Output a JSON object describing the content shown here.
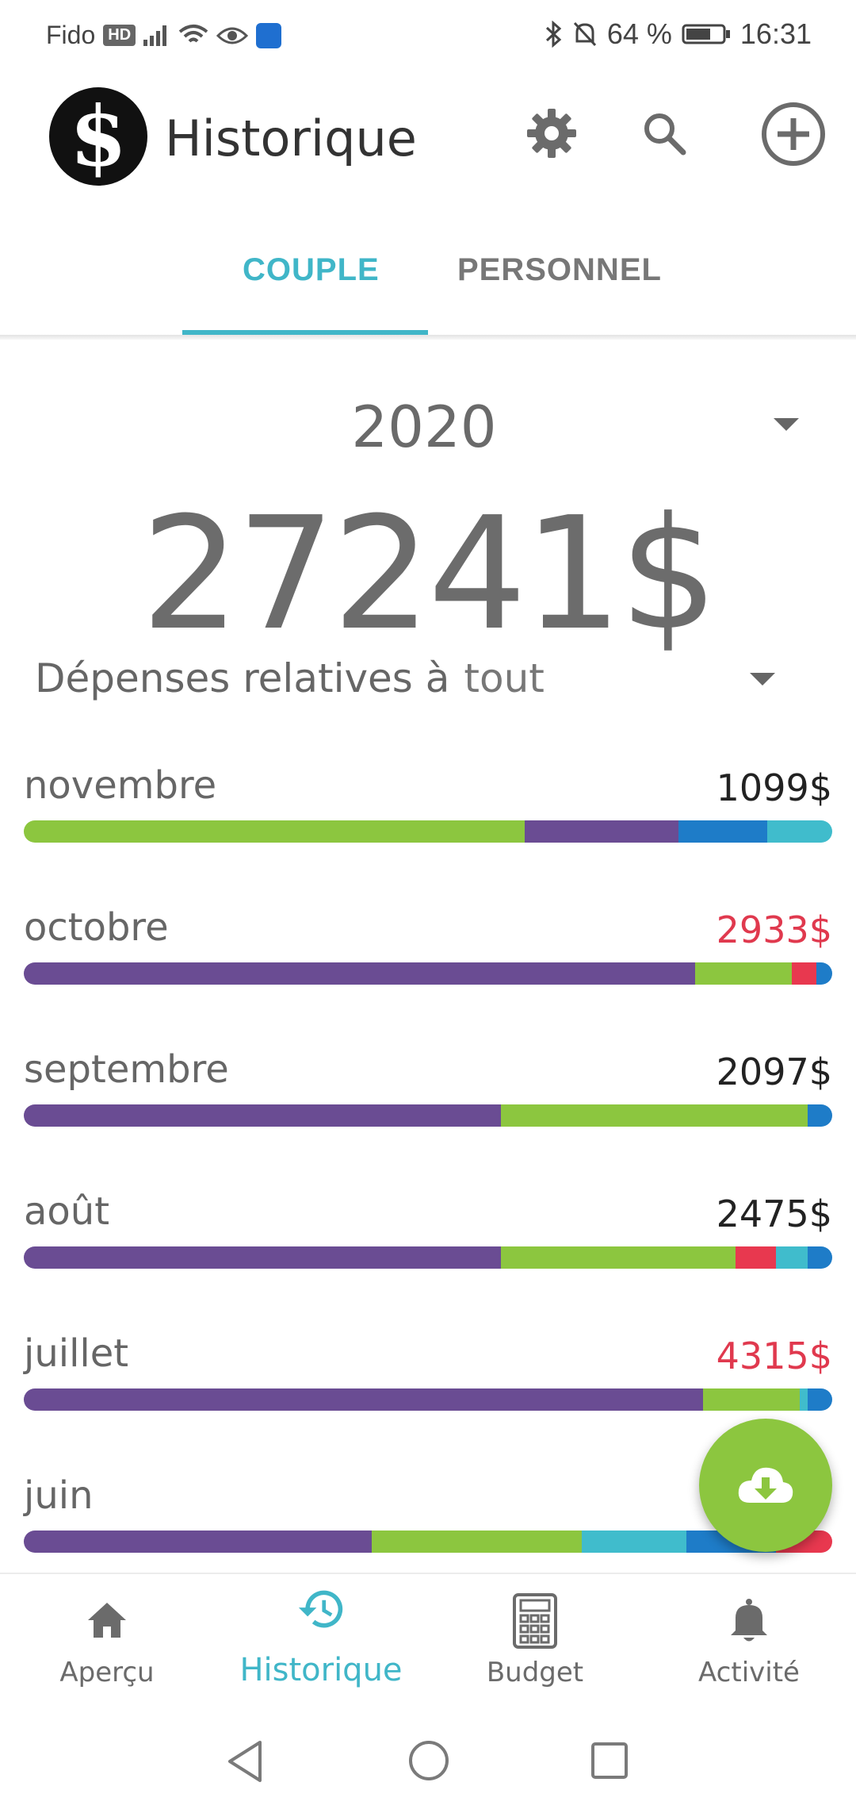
{
  "status_bar": {
    "carrier": "Fido",
    "hd": "HD",
    "battery": "64 %",
    "time": "16:31"
  },
  "app_bar": {
    "logo": "$",
    "title": "Historique",
    "icons": [
      "gear-icon",
      "search-icon",
      "add-circle-icon"
    ]
  },
  "tabs": [
    {
      "label": "COUPLE",
      "active": true
    },
    {
      "label": "PERSONNEL",
      "active": false
    }
  ],
  "summary": {
    "year": "2020",
    "total": "27241$",
    "relative_label": "Dépenses relatives à",
    "relative_value": "tout"
  },
  "colors": {
    "accent": "#40b6c8",
    "green": "#8cc63f",
    "purple": "#6a4c93",
    "blue": "#1e7cc8",
    "cyan": "#40bccc",
    "red": "#e8384f",
    "over_budget": "#e0394e"
  },
  "months": [
    {
      "name": "novembre",
      "amount": "1099$",
      "over": false,
      "segments": [
        {
          "c": "#8cc63f",
          "f": 0.62
        },
        {
          "c": "#6a4c93",
          "f": 0.19
        },
        {
          "c": "#1e7cc8",
          "f": 0.11
        },
        {
          "c": "#40bccc",
          "f": 0.08
        }
      ]
    },
    {
      "name": "octobre",
      "amount": "2933$",
      "over": true,
      "segments": [
        {
          "c": "#6a4c93",
          "f": 0.83
        },
        {
          "c": "#8cc63f",
          "f": 0.12
        },
        {
          "c": "#e8384f",
          "f": 0.03
        },
        {
          "c": "#1e7cc8",
          "f": 0.02
        }
      ]
    },
    {
      "name": "septembre",
      "amount": "2097$",
      "over": false,
      "segments": [
        {
          "c": "#6a4c93",
          "f": 0.59
        },
        {
          "c": "#8cc63f",
          "f": 0.38
        },
        {
          "c": "#1e7cc8",
          "f": 0.03
        }
      ]
    },
    {
      "name": "août",
      "amount": "2475$",
      "over": false,
      "segments": [
        {
          "c": "#6a4c93",
          "f": 0.59
        },
        {
          "c": "#8cc63f",
          "f": 0.29
        },
        {
          "c": "#e8384f",
          "f": 0.05
        },
        {
          "c": "#40bccc",
          "f": 0.04
        },
        {
          "c": "#1e7cc8",
          "f": 0.03
        }
      ]
    },
    {
      "name": "juillet",
      "amount": "4315$",
      "over": true,
      "segments": [
        {
          "c": "#6a4c93",
          "f": 0.84
        },
        {
          "c": "#8cc63f",
          "f": 0.12
        },
        {
          "c": "#40bccc",
          "f": 0.01
        },
        {
          "c": "#1e7cc8",
          "f": 0.03
        }
      ]
    },
    {
      "name": "juin",
      "amount": "",
      "over": true,
      "segments": [
        {
          "c": "#6a4c93",
          "f": 0.43
        },
        {
          "c": "#8cc63f",
          "f": 0.26
        },
        {
          "c": "#40bccc",
          "f": 0.13
        },
        {
          "c": "#1e7cc8",
          "f": 0.11
        },
        {
          "c": "#e8384f",
          "f": 0.07
        }
      ]
    }
  ],
  "fab": {
    "icon": "cloud-download-icon"
  },
  "bottom_nav": [
    {
      "label": "Aperçu",
      "icon": "home-icon",
      "active": false
    },
    {
      "label": "Historique",
      "icon": "history-icon",
      "active": true
    },
    {
      "label": "Budget",
      "icon": "calculator-icon",
      "active": false
    },
    {
      "label": "Activité",
      "icon": "bell-icon",
      "active": false
    }
  ],
  "system_nav": [
    "back-icon",
    "home-circle-icon",
    "recents-icon"
  ]
}
